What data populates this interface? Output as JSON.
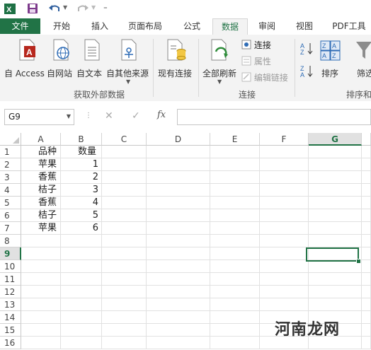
{
  "app": {
    "title_bar_icons": [
      "excel-logo-icon",
      "save-icon",
      "undo-icon",
      "redo-icon",
      "customize-qat-icon"
    ]
  },
  "tabs": [
    {
      "id": "file",
      "label": "文件"
    },
    {
      "id": "home",
      "label": "开始"
    },
    {
      "id": "insert",
      "label": "插入"
    },
    {
      "id": "layout",
      "label": "页面布局"
    },
    {
      "id": "formulas",
      "label": "公式"
    },
    {
      "id": "data",
      "label": "数据"
    },
    {
      "id": "review",
      "label": "审阅"
    },
    {
      "id": "view",
      "label": "视图"
    },
    {
      "id": "pdf",
      "label": "PDF工具"
    }
  ],
  "active_tab": "数据",
  "ribbon": {
    "get_external": {
      "group_label": "获取外部数据",
      "buttons": [
        "自 Access",
        "自网站",
        "自文本",
        "自其他来源"
      ]
    },
    "existing_connections": "现有连接",
    "connections": {
      "group_label": "连接",
      "refresh_all": "全部刷新",
      "items": [
        "连接",
        "属性",
        "编辑链接"
      ]
    },
    "sort_filter": {
      "group_label": "排序和",
      "sort": "排序",
      "filter": "筛选"
    }
  },
  "formula_bar": {
    "name_box": "G9",
    "fx": "fx",
    "value": ""
  },
  "sheet": {
    "columns": [
      "A",
      "B",
      "C",
      "D",
      "E",
      "F",
      "G"
    ],
    "rows": [
      "1",
      "2",
      "3",
      "4",
      "5",
      "6",
      "7",
      "8",
      "9",
      "10",
      "11",
      "12",
      "13",
      "14",
      "15",
      "16"
    ],
    "cells": {
      "A1": "品种",
      "B1": "数量",
      "A2": "苹果",
      "B2": "1",
      "A3": "香蕉",
      "B3": "2",
      "A4": "桔子",
      "B4": "3",
      "A5": "香蕉",
      "B5": "4",
      "A6": "桔子",
      "B6": "5",
      "A7": "苹果",
      "B7": "6"
    },
    "selected_cell": "G9"
  },
  "watermark": "河南龙网",
  "colors": {
    "accent": "#217346",
    "file_tab": "#217346",
    "ribbon_bg": "#f3f3f3"
  }
}
